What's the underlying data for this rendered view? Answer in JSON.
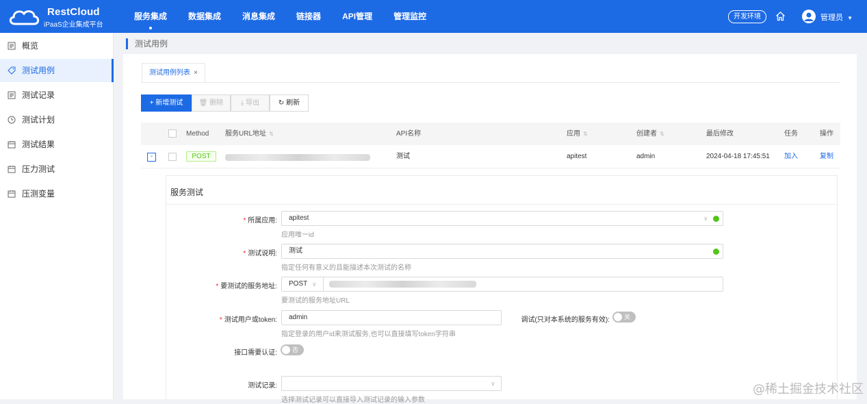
{
  "app": {
    "title": "RestCloud",
    "subtitle": "iPaaS企业集成平台"
  },
  "nav": {
    "items": [
      "服务集成",
      "数据集成",
      "消息集成",
      "链接器",
      "API管理",
      "管理监控"
    ]
  },
  "header": {
    "env_label": "开发环境",
    "user_name": "管理员"
  },
  "sidebar": {
    "items": [
      "概览",
      "测试用例",
      "测试记录",
      "测试计划",
      "测试结果",
      "压力测试",
      "压测变量"
    ]
  },
  "breadcrumb": "测试用例",
  "tab": {
    "label": "测试用例列表",
    "close": "×"
  },
  "toolbar": {
    "new_label": "+ 新增测试",
    "delete_label": "删除",
    "export_label": "导出",
    "refresh_label": "刷新"
  },
  "table": {
    "headers": [
      "Method",
      "服务URL地址",
      "API名称",
      "应用",
      "创建者",
      "最后修改",
      "任务",
      "操作"
    ],
    "row": {
      "method": "POST",
      "api_name": "测试",
      "app": "apitest",
      "creator": "admin",
      "modified": "2024-04-18 17:45:51",
      "task": "加入",
      "action": "复制"
    }
  },
  "form": {
    "title": "服务测试",
    "app_label": "所属应用:",
    "app_value": "apitest",
    "app_hint": "应用唯一id",
    "desc_label": "测试说明:",
    "desc_value": "测试",
    "desc_hint": "指定任何有意义的且能描述本次测试的名称",
    "url_label": "要测试的服务地址:",
    "url_method": "POST",
    "url_hint": "要测试的服务地址URL",
    "token_label": "测试用户或token:",
    "token_value": "admin",
    "token_hint": "指定登录的用户id来测试服务,也可以直接填写token字符串",
    "debug_label": "调试(只对本系统的服务有效):",
    "debug_switch": "关闭",
    "auth_label": "接口需要认证:",
    "auth_switch": "否",
    "record_label": "测试记录:",
    "record_hint": "选择测试记录可以直接导入测试记录的输入参数"
  },
  "watermark": "@稀土掘金技术社区",
  "colors": {
    "primary": "#1d6ae5",
    "success": "#52c41a",
    "required": "#f5222d"
  }
}
